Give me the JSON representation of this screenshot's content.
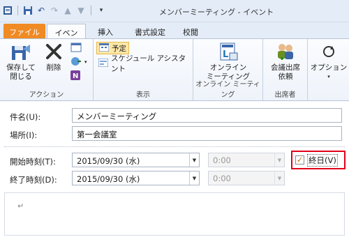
{
  "window": {
    "title": "メンバーミーティング - イベント"
  },
  "qat": {
    "save_icon": "save-icon",
    "undo_icon": "undo-icon",
    "redo_icon": "redo-icon",
    "up_icon": "up-arrow-icon",
    "down_icon": "down-arrow-icon",
    "customize_icon": "customize-qat-icon"
  },
  "tabs": {
    "file": "ファイル",
    "event": "イベント",
    "insert": "挿入",
    "format": "書式設定",
    "review": "校閲"
  },
  "ribbon": {
    "actions": {
      "label": "アクション",
      "save_close_line1": "保存して",
      "save_close_line2": "閉じる",
      "delete": "削除"
    },
    "show": {
      "label": "表示",
      "appointment": "予定",
      "scheduling": "スケジュール アシスタント"
    },
    "online": {
      "label": "オンライン ミーティング",
      "btn_line1": "オンライン",
      "btn_line2": "ミーティング"
    },
    "attendees": {
      "label": "出席者",
      "btn_line1": "会議出席",
      "btn_line2": "依頼"
    },
    "options": {
      "label": "オプション"
    }
  },
  "form": {
    "subject_label": "件名(U):",
    "subject_value": "メンバーミーティング",
    "location_label": "場所(I):",
    "location_value": "第一会議室",
    "start_label": "開始時刻(T):",
    "start_date": "2015/09/30 (水)",
    "start_time": "0:00",
    "end_label": "終了時刻(D):",
    "end_date": "2015/09/30 (水)",
    "end_time": "0:00",
    "allday_label": "終日(V)",
    "allday_checked": "✓",
    "body_mark": "↵"
  },
  "colors": {
    "file_tab": "#f08a24",
    "highlight": "#e2001a",
    "selected": "#fde7a6"
  }
}
